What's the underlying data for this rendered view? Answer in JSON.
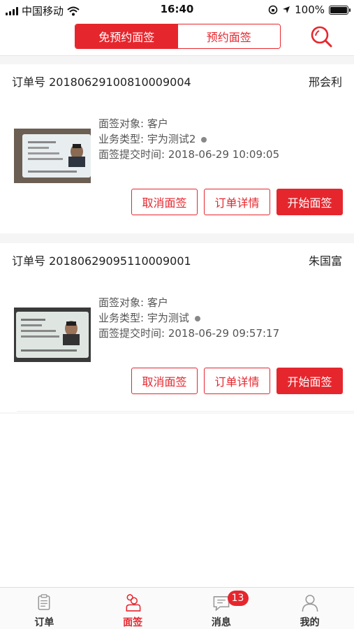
{
  "status_bar": {
    "carrier": "中国移动",
    "time": "16:40",
    "battery_percent": "100%",
    "battery_level": 1.0
  },
  "header": {
    "tabs": [
      {
        "label": "免预约面签",
        "active": true
      },
      {
        "label": "预约面签",
        "active": false
      }
    ],
    "search_icon": "search-icon"
  },
  "orders": [
    {
      "order_label": "订单号",
      "order_no": "20180629100810009004",
      "customer": "邢会利",
      "target_label": "面签对象: ",
      "target": "客户",
      "biz_label": "业务类型: ",
      "biz_type": "宇为测试2",
      "time_label": "面签提交时间: ",
      "submit_time": "2018-06-29 10:09:05",
      "buttons": {
        "cancel": "取消面签",
        "detail": "订单详情",
        "start": "开始面签"
      }
    },
    {
      "order_label": "订单号",
      "order_no": "20180629095110009001",
      "customer": "朱国富",
      "target_label": "面签对象: ",
      "target": "客户",
      "biz_label": "业务类型: ",
      "biz_type": "宇为测试",
      "time_label": "面签提交时间: ",
      "submit_time": "2018-06-29 09:57:17",
      "buttons": {
        "cancel": "取消面签",
        "detail": "订单详情",
        "start": "开始面签"
      }
    }
  ],
  "tabbar": {
    "items": [
      {
        "label": "订单",
        "icon": "order-icon",
        "active": false
      },
      {
        "label": "面签",
        "icon": "interview-icon",
        "active": true
      },
      {
        "label": "消息",
        "icon": "message-icon",
        "active": false,
        "badge": "13"
      },
      {
        "label": "我的",
        "icon": "profile-icon",
        "active": false
      }
    ]
  },
  "colors": {
    "accent": "#e6262d"
  }
}
